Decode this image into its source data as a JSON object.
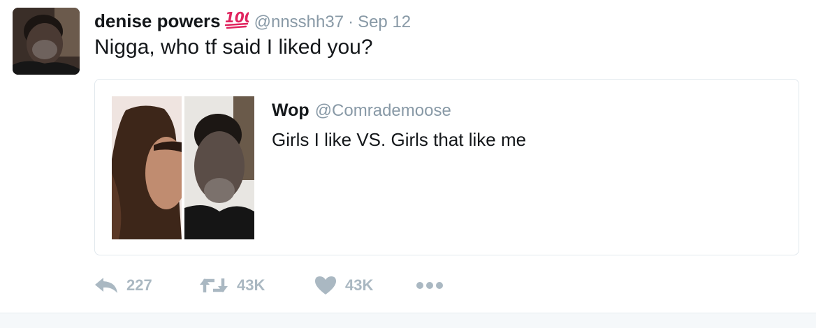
{
  "tweet": {
    "author_name": "denise powers",
    "author_emoji": "💯",
    "handle": "@nnsshh37",
    "separator": "·",
    "date": "Sep 12",
    "text": "Nigga, who tf said I liked you?",
    "quoted": {
      "author_name": "Wop",
      "handle": "@Comrademoose",
      "text": "Girls I like VS. Girls that like me"
    },
    "actions": {
      "reply_icon": "reply-icon",
      "reply_count": "227",
      "retweet_icon": "retweet-icon",
      "retweet_count": "43K",
      "like_icon": "heart-icon",
      "like_count": "43K",
      "more_icon": "more-icon"
    }
  },
  "colors": {
    "text": "#14171a",
    "secondary": "#8899a6",
    "action_gray": "#aab8c2",
    "border": "#e1e8ed",
    "footer_bg": "#f5f8fa",
    "emoji_red": "#e0245e"
  }
}
